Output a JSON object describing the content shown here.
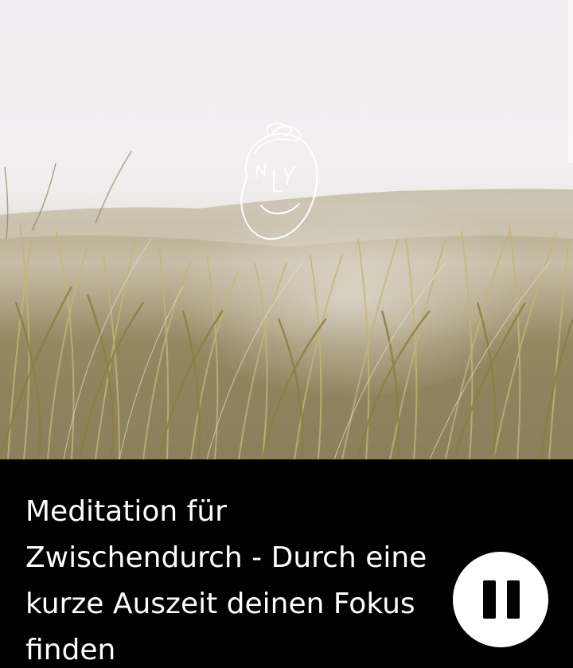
{
  "cover": {
    "logo_icon": "face-logo-icon",
    "logo_letters": "NLY"
  },
  "player": {
    "episode_title": "Meditation für Zwischendurch - Durch eine kurze Auszeit deinen Fokus finden",
    "state": "playing",
    "control_icon": "pause-icon",
    "colors": {
      "background": "#000000",
      "title_text": "#ffffff",
      "button": "#ffffff",
      "button_icon": "#000000"
    }
  }
}
